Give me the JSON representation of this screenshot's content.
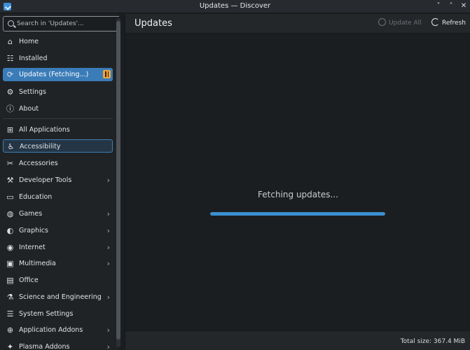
{
  "window": {
    "title": "Updates — Discover",
    "controls": [
      "˅",
      "˄",
      "✕"
    ]
  },
  "search": {
    "placeholder": "Search in 'Updates'..."
  },
  "sidebar": {
    "top_items": [
      {
        "label": "Home",
        "icon": "home-icon",
        "glyph": "⌂"
      },
      {
        "label": "Installed",
        "icon": "installed-icon",
        "glyph": "☷"
      },
      {
        "label": "Updates (Fetching...)",
        "icon": "updates-icon",
        "glyph": "⟳"
      },
      {
        "label": "Settings",
        "icon": "settings-icon",
        "glyph": "⚙"
      },
      {
        "label": "About",
        "icon": "about-icon",
        "glyph": "ⓘ"
      }
    ],
    "categories": [
      {
        "label": "All Applications",
        "icon": "all-apps-icon",
        "glyph": "⊞",
        "chevron": false
      },
      {
        "label": "Accessibility",
        "icon": "accessibility-icon",
        "glyph": "♿",
        "chevron": false
      },
      {
        "label": "Accessories",
        "icon": "accessories-icon",
        "glyph": "✂",
        "chevron": false
      },
      {
        "label": "Developer Tools",
        "icon": "developer-tools-icon",
        "glyph": "⚒",
        "chevron": true
      },
      {
        "label": "Education",
        "icon": "education-icon",
        "glyph": "▭",
        "chevron": false
      },
      {
        "label": "Games",
        "icon": "games-icon",
        "glyph": "◍",
        "chevron": true
      },
      {
        "label": "Graphics",
        "icon": "graphics-icon",
        "glyph": "◐",
        "chevron": true
      },
      {
        "label": "Internet",
        "icon": "internet-icon",
        "glyph": "◉",
        "chevron": true
      },
      {
        "label": "Multimedia",
        "icon": "multimedia-icon",
        "glyph": "▣",
        "chevron": true
      },
      {
        "label": "Office",
        "icon": "office-icon",
        "glyph": "▤",
        "chevron": false
      },
      {
        "label": "Science and Engineering",
        "icon": "science-icon",
        "glyph": "⚗",
        "chevron": true
      },
      {
        "label": "System Settings",
        "icon": "system-settings-icon",
        "glyph": "☰",
        "chevron": false
      },
      {
        "label": "Application Addons",
        "icon": "application-addons-icon",
        "glyph": "⊕",
        "chevron": true
      },
      {
        "label": "Plasma Addons",
        "icon": "plasma-addons-icon",
        "glyph": "✦",
        "chevron": true
      }
    ],
    "chevron_glyph": "›"
  },
  "main": {
    "title": "Updates",
    "update_all_label": "Update All",
    "refresh_label": "Refresh",
    "status_text": "Fetching updates...",
    "progress_fraction": 1.0,
    "total_size": "Total size: 367.4 MiB"
  },
  "colors": {
    "accent": "#3a7cb8",
    "badge": "#f0a43e",
    "progress": "#3d8fd0"
  }
}
